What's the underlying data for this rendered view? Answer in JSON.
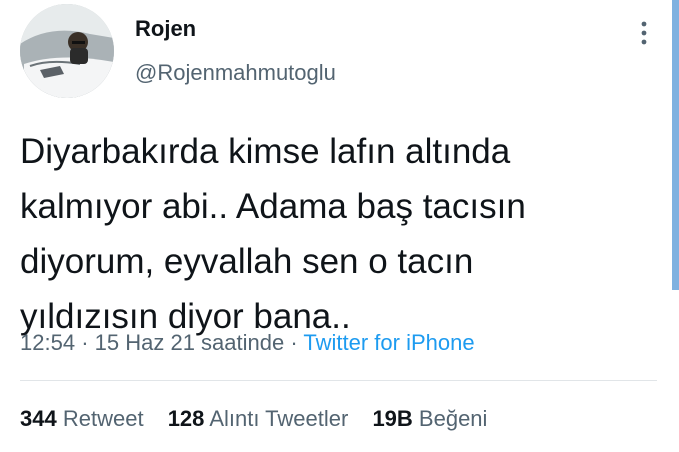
{
  "author": {
    "display_name": "Rojen",
    "handle": "@Rojenmahmutoglu",
    "avatar_icon": "profile-photo"
  },
  "tweet": {
    "lines": [
      "Diyarbakırda kimse lafın altında",
      "kalmıyor abi.. Adama baş tacısın",
      "diyorum, eyvallah sen o tacın",
      "yıldızısın diyor bana.."
    ],
    "time": "12:54",
    "date_text": "15 Haz 21 saatinde",
    "separator": "·",
    "source": "Twitter for iPhone"
  },
  "stats": {
    "retweets_count": "344",
    "retweets_label": "Retweet",
    "quotes_count": "128",
    "quotes_label": "Alıntı Tweetler",
    "likes_count": "19B",
    "likes_label": "Beğeni"
  },
  "colors": {
    "text": "#0f1419",
    "muted": "#536471",
    "link": "#1d9bf0",
    "divider": "#e1e5e8",
    "scrollbar": "#7fb1e0"
  },
  "icons": {
    "more_menu": "more-vertical-icon"
  }
}
